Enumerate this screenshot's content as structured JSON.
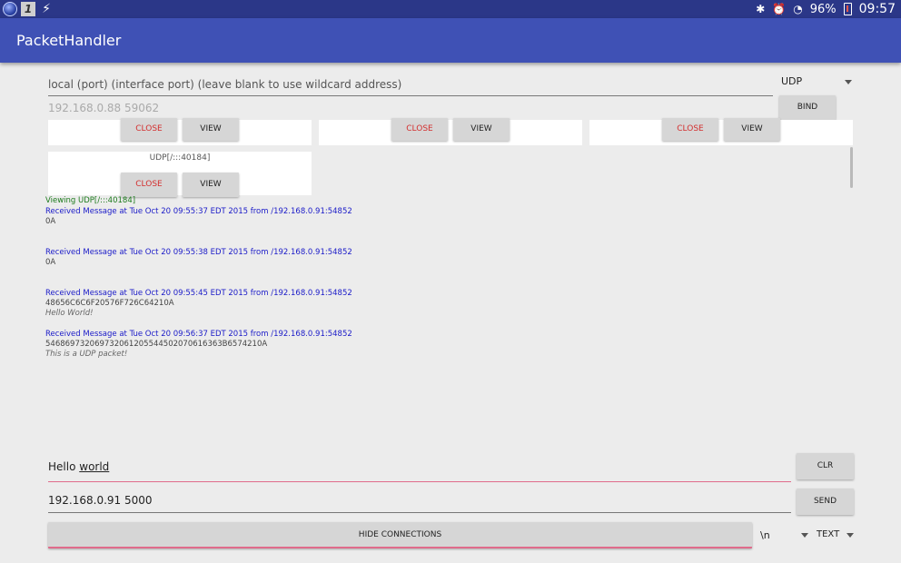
{
  "status_bar": {
    "left_icons": [
      "globe-icon",
      "number-one-icon",
      "bolt-icon"
    ],
    "battery": "96%",
    "time": "09:57"
  },
  "app_bar": {
    "title": "PacketHandler"
  },
  "bind": {
    "local_placeholder": "local (port) (interface port) (leave blank to use wildcard address)",
    "remote_placeholder": "192.168.0.88 59062",
    "protocol": "UDP",
    "bind_label": "BIND"
  },
  "connections": [
    {
      "label": "",
      "close_label": "CLOSE",
      "view_label": "VIEW"
    },
    {
      "label": "",
      "close_label": "CLOSE",
      "view_label": "VIEW"
    },
    {
      "label": "",
      "close_label": "CLOSE",
      "view_label": "VIEW"
    },
    {
      "label": "UDP[/:::40184]",
      "close_label": "CLOSE",
      "view_label": "VIEW"
    }
  ],
  "log": {
    "viewing": "Viewing UDP[/:::40184]",
    "messages": [
      {
        "header": "Received Message at Tue Oct 20 09:55:37 EDT 2015 from /192.168.0.91:54852",
        "hex": "0A",
        "text": ""
      },
      {
        "header": "Received Message at Tue Oct 20 09:55:38 EDT 2015 from /192.168.0.91:54852",
        "hex": "0A",
        "text": ""
      },
      {
        "header": "Received Message at Tue Oct 20 09:55:45 EDT 2015 from /192.168.0.91:54852",
        "hex": "48656C6C6F20576F726C64210A",
        "text": "Hello World!"
      },
      {
        "header": "Received Message at Tue Oct 20 09:56:37 EDT 2015 from /192.168.0.91:54852",
        "hex": "546869732069732061205544502070616363B6574210A",
        "text": "This is a UDP packet!"
      }
    ]
  },
  "compose": {
    "message_word1": "Hello",
    "message_word2": "world",
    "address": "192.168.0.91 5000",
    "clr_label": "CLR",
    "send_label": "SEND",
    "hide_label": "HIDE CONNECTIONS",
    "delimiter": "\\n",
    "format": "TEXT"
  },
  "colors": {
    "app_bar": "#3f51b5",
    "status_bar": "#2b3788",
    "accent": "#e06b8b",
    "close_text": "#d32f2f",
    "log_header": "#1a1ac8",
    "viewing_text": "#1b7a1b"
  }
}
